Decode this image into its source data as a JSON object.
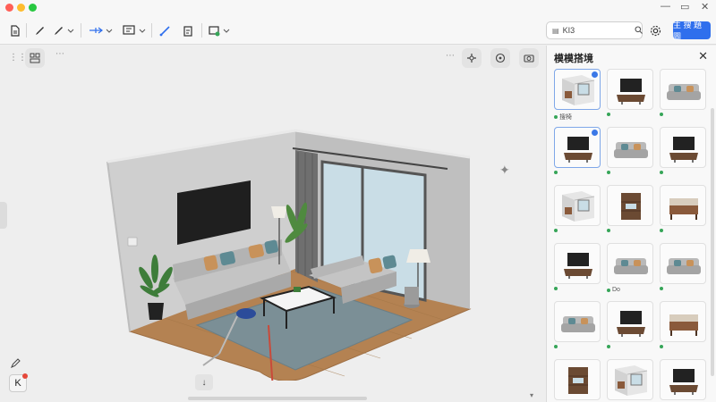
{
  "search": {
    "value": "KI3"
  },
  "toolbar": {
    "primary_label": "主 搜 題 圖"
  },
  "panel": {
    "title": "模模搭境",
    "items": [
      {
        "label": "搜椅",
        "variant": "room",
        "selected": true
      },
      {
        "label": "",
        "variant": "tv"
      },
      {
        "label": "",
        "variant": "sofa"
      },
      {
        "label": "",
        "variant": "tv",
        "selected": true
      },
      {
        "label": "",
        "variant": "sofa"
      },
      {
        "label": "",
        "variant": "tv"
      },
      {
        "label": "",
        "variant": "room"
      },
      {
        "label": "",
        "variant": "cabinet"
      },
      {
        "label": "",
        "variant": "bench"
      },
      {
        "label": "",
        "variant": "tv"
      },
      {
        "label": "Do",
        "variant": "sofa"
      },
      {
        "label": "",
        "variant": "sofa"
      },
      {
        "label": "",
        "variant": "sofa"
      },
      {
        "label": "",
        "variant": "tv"
      },
      {
        "label": "",
        "variant": "bench"
      },
      {
        "label": "",
        "variant": "cabinet"
      },
      {
        "label": "",
        "variant": "room"
      },
      {
        "label": "",
        "variant": "tv"
      }
    ]
  },
  "colors": {
    "accent": "#2f6fed",
    "floor": "#b9834f",
    "wall": "#c9c9c9",
    "rug": "#7d8f96",
    "sofa": "#b8b8b8",
    "status_green": "#36a558"
  }
}
